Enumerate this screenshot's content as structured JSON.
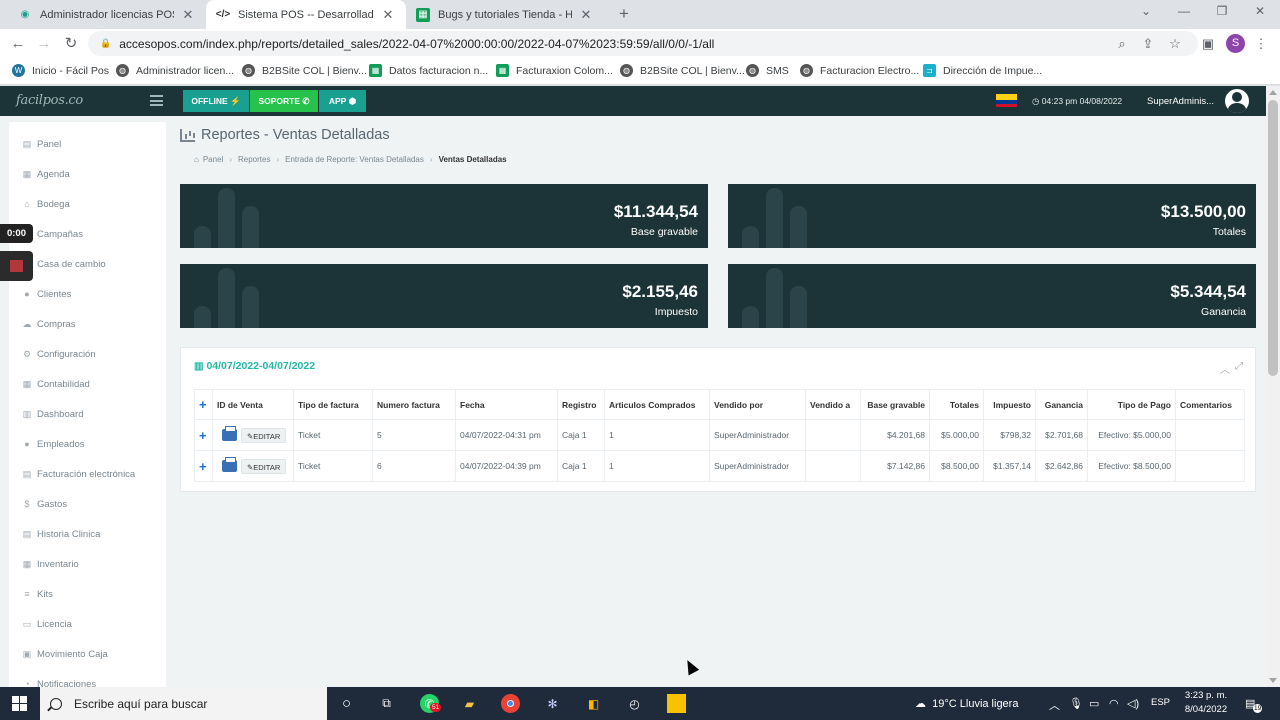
{
  "browser": {
    "tabs": [
      {
        "title": "Administrador licencias POS",
        "favicon": "admin-icon"
      },
      {
        "title": "Sistema POS -- Desarrollado por",
        "favicon": "code-icon"
      },
      {
        "title": "Bugs y tutoriales Tienda - Hojas",
        "favicon": "sheets-icon"
      }
    ],
    "url": "accesopos.com/index.php/reports/detailed_sales/2022-04-07%2000:00:00/2022-04-07%2023:59:59/all/0/0/-1/all",
    "profile_initial": "S",
    "bookmarks": [
      "Inicio - Fácil Pos",
      "Administrador licen...",
      "B2BSite COL | Bienv...",
      "Datos facturacion n...",
      "Facturaxion Colom...",
      "B2BSite COL | Bienv...",
      "SMS",
      "Facturacion Electro...",
      "Dirección de Impue..."
    ]
  },
  "app": {
    "logo": "facilpos.co",
    "buttons": {
      "offline": "OFFLINE",
      "soporte": "SOPORTE",
      "app": "APP"
    },
    "datetime": "04:23 pm 04/08/2022",
    "user": "SuperAdminis...",
    "colors": {
      "header": "#1c3338",
      "accent": "#23b7a5",
      "offline_btn": "#1aa090",
      "soporte_btn": "#27c24c"
    }
  },
  "sidebar": {
    "items": [
      {
        "label": "Panel",
        "icon": "panel-icon"
      },
      {
        "label": "Agenda",
        "icon": "calendar-icon"
      },
      {
        "label": "Bodega",
        "icon": "bank-icon"
      },
      {
        "label": "Campañas",
        "icon": "megaphone-icon"
      },
      {
        "label": "Casa de cambio",
        "icon": "money-icon"
      },
      {
        "label": "Clientes",
        "icon": "users-icon"
      },
      {
        "label": "Compras",
        "icon": "cloud-icon"
      },
      {
        "label": "Configuración",
        "icon": "cogs-icon"
      },
      {
        "label": "Contabilidad",
        "icon": "table-icon"
      },
      {
        "label": "Dashboard",
        "icon": "dashboard-icon"
      },
      {
        "label": "Empleados",
        "icon": "user-icon"
      },
      {
        "label": "Facturación electrónica",
        "icon": "invoice-icon"
      },
      {
        "label": "Gastos",
        "icon": "dollar-icon"
      },
      {
        "label": "Historia Clinica",
        "icon": "clipboard-icon"
      },
      {
        "label": "Inventario",
        "icon": "inventory-icon"
      },
      {
        "label": "Kits",
        "icon": "list-icon"
      },
      {
        "label": "Licencia",
        "icon": "license-icon"
      },
      {
        "label": "Movimiento Caja",
        "icon": "cashbox-icon"
      },
      {
        "label": "Notificaciones",
        "icon": "bell-icon"
      }
    ]
  },
  "recorder": {
    "time": "0:00"
  },
  "page": {
    "title": "Reportes - Ventas Detalladas",
    "breadcrumb": [
      "Panel",
      "Reportes",
      "Entrada de Reporte: Ventas Detalladas",
      "Ventas Detalladas"
    ]
  },
  "cards": [
    {
      "value": "$11.344,54",
      "label": "Base gravable"
    },
    {
      "value": "$13.500,00",
      "label": "Totales"
    },
    {
      "value": "$2.155,46",
      "label": "Impuesto"
    },
    {
      "value": "$5.344,54",
      "label": "Ganancia"
    }
  ],
  "report": {
    "date_range": "04/07/2022-04/07/2022",
    "columns": [
      "ID de Venta",
      "Tipo de factura",
      "Numero factura",
      "Fecha",
      "Registro",
      "Articulos Comprados",
      "Vendido por",
      "Vendido a",
      "Base gravable",
      "Totales",
      "Impuesto",
      "Ganancia",
      "Tipo de Pago",
      "Comentarios"
    ],
    "edit_label": "EDITAR",
    "rows": [
      {
        "tipo": "Ticket",
        "numero": "5",
        "fecha": "04/07/2022-04:31 pm",
        "registro": "Caja 1",
        "articulos": "1",
        "vendido_por": "SuperAdministrador",
        "vendido_a": "",
        "base": "$4.201,68",
        "totales": "$5.000,00",
        "impuesto": "$798,32",
        "ganancia": "$2.701,68",
        "pago": "Efectivo: $5.000,00",
        "comentarios": ""
      },
      {
        "tipo": "Ticket",
        "numero": "6",
        "fecha": "04/07/2022-04:39 pm",
        "registro": "Caja 1",
        "articulos": "1",
        "vendido_por": "SuperAdministrador",
        "vendido_a": "",
        "base": "$7.142,86",
        "totales": "$8.500,00",
        "impuesto": "$1.357,14",
        "ganancia": "$2.642,86",
        "pago": "Efectivo: $8.500,00",
        "comentarios": ""
      }
    ]
  },
  "taskbar": {
    "search_placeholder": "Escribe aquí para buscar",
    "whatsapp_badge": "51",
    "weather": "19°C  Lluvia ligera",
    "lang": "ESP",
    "time": "3:23 p. m.",
    "date": "8/04/2022",
    "notif_count": "19"
  }
}
